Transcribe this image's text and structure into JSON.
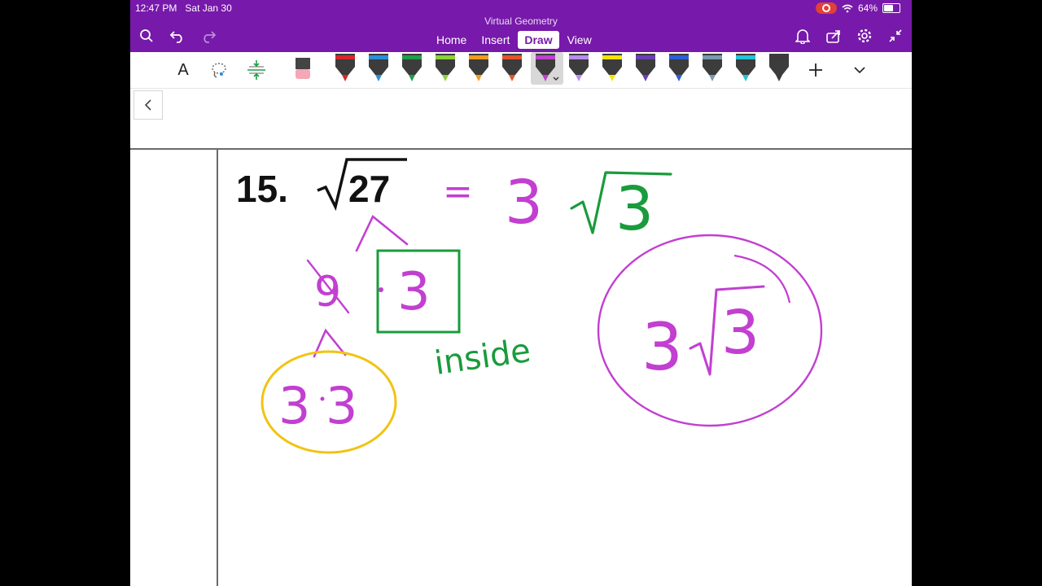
{
  "status": {
    "time": "12:47 PM",
    "date": "Sat Jan 30",
    "battery": "64%",
    "battery_level": 0.64
  },
  "app": {
    "title": "Virtual Geometry"
  },
  "tabs": [
    {
      "label": "Home",
      "active": false
    },
    {
      "label": "Insert",
      "active": false
    },
    {
      "label": "Draw",
      "active": true
    },
    {
      "label": "View",
      "active": false
    }
  ],
  "toolbar": {
    "text_tool_label": "A",
    "pens": [
      {
        "color": "#d62828"
      },
      {
        "color": "#2a8fd9"
      },
      {
        "color": "#1f9e4a"
      },
      {
        "color": "#8bd13a"
      },
      {
        "color": "#f29b1d"
      },
      {
        "color": "#e5542a"
      },
      {
        "color": "#c23fd1",
        "selected": true
      },
      {
        "color": "#b98cf0"
      },
      {
        "color": "#f5e400"
      },
      {
        "color": "#6a3fb8"
      },
      {
        "color": "#2b5fd9"
      },
      {
        "color": "#7a9ab0"
      },
      {
        "color": "#22c4d6"
      },
      {
        "color": "#3a3a3a"
      }
    ]
  },
  "note": {
    "problem_number": "15.",
    "radicand": "27",
    "handwriting": {
      "equals": "=",
      "coefficient": "3",
      "radicand_result": "3",
      "factor_left": "9",
      "factor_boxed": "3",
      "word": "inside",
      "factored_left": "3",
      "factored_right": "3",
      "final_coefficient": "3",
      "final_radicand": "3"
    }
  },
  "colors": {
    "ribbon": "#7719aa",
    "ink_magenta": "#c23fd1",
    "ink_green": "#1a9b3c",
    "ink_yellow": "#f2c313"
  }
}
